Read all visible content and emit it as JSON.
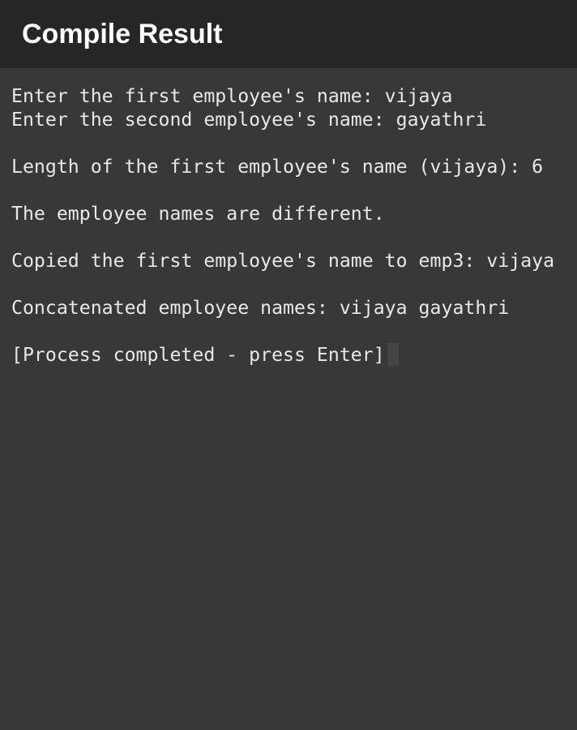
{
  "app_bar": {
    "title": "Compile Result"
  },
  "terminal": {
    "lines": [
      "Enter the first employee's name: vijaya",
      "Enter the second employee's name: gayathri",
      "",
      "Length of the first employee's name (vijaya): 6",
      "",
      "The employee names are different.",
      "",
      "Copied the first employee's name to emp3: vijaya",
      "",
      "Concatenated employee names: vijaya gayathri",
      "",
      "[Process completed - press Enter]"
    ]
  }
}
